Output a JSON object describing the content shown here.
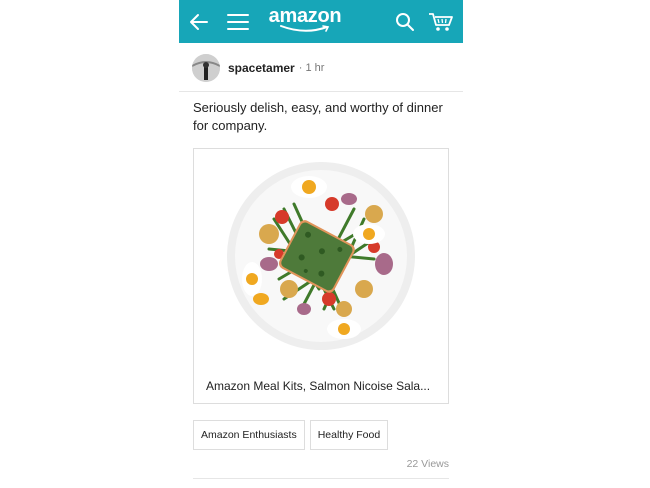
{
  "topbar": {
    "logo_text": "amazon",
    "back_icon": "arrow-left-icon",
    "menu_icon": "hamburger-menu-icon",
    "search_icon": "search-icon",
    "cart_icon": "cart-icon",
    "accent_color": "#17a6b8"
  },
  "post": {
    "username": "spacetamer",
    "time": "· 1 hr",
    "text": "Seriously delish, easy, and worthy of dinner for company.",
    "card": {
      "caption": "Amazon Meal Kits, Salmon Nicoise Sala..."
    },
    "tags": [
      "Amazon Enthusiasts",
      "Healthy Food"
    ],
    "views": "22 Views"
  }
}
